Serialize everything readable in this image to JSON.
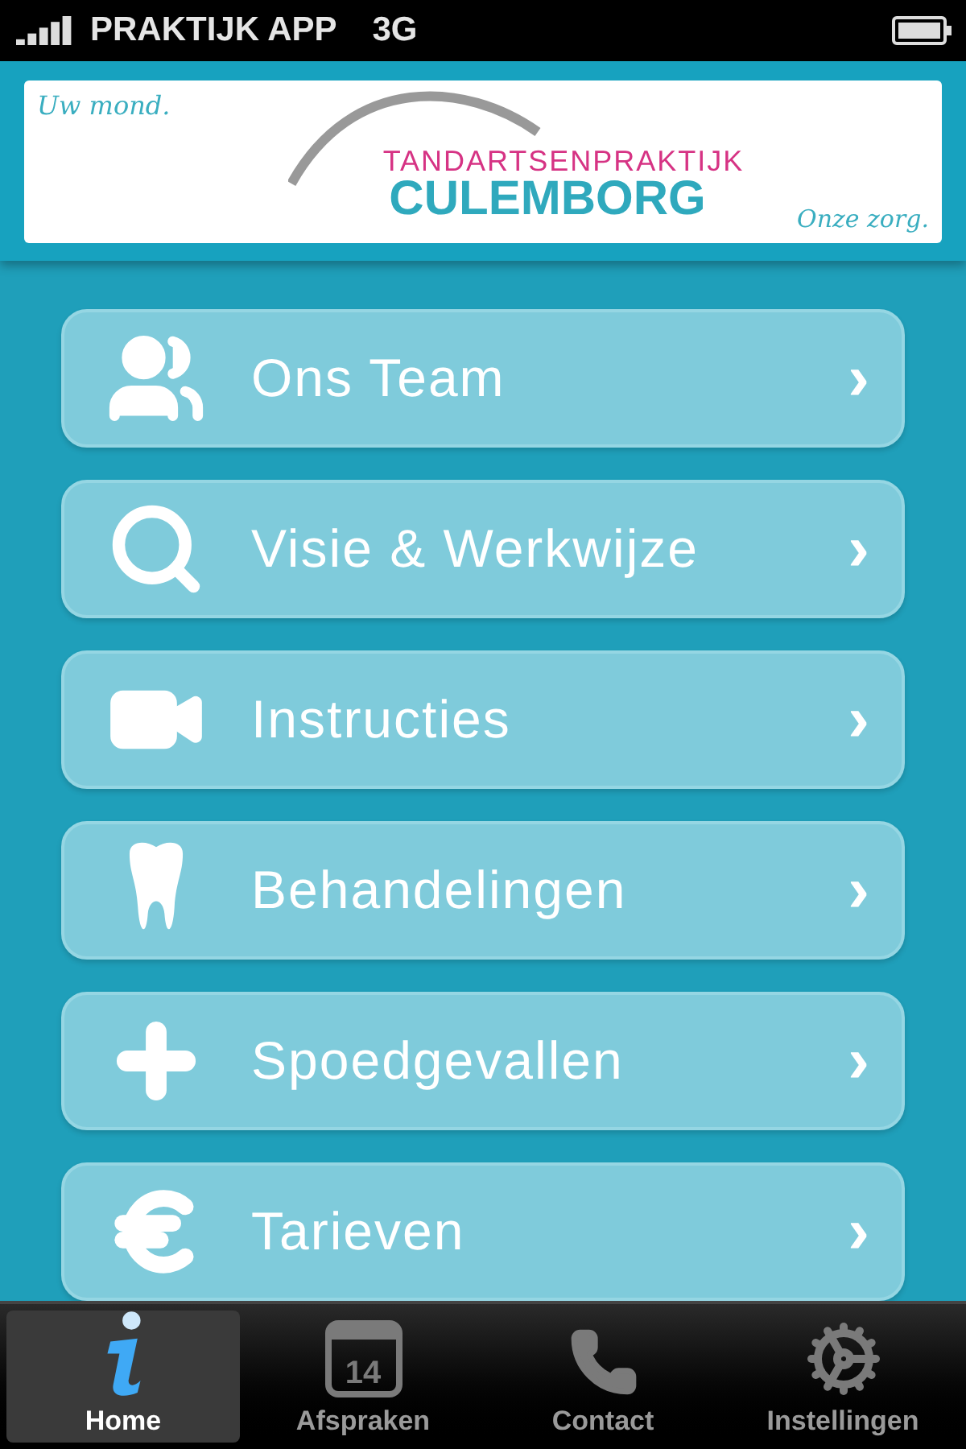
{
  "status_bar": {
    "carrier": "PRAKTIJK APP",
    "network": "3G"
  },
  "banner": {
    "slogan_left": "Uw mond.",
    "logo_top": "TANDARTSENPRAKTIJK",
    "logo_bottom": "CULEMBORG",
    "slogan_right": "Onze zorg."
  },
  "menu": [
    {
      "kind": "team",
      "label": "Ons Team",
      "chevron": "›"
    },
    {
      "kind": "search",
      "label": "Visie & Werkwijze",
      "chevron": "›"
    },
    {
      "kind": "video",
      "label": "Instructies",
      "chevron": "›"
    },
    {
      "kind": "tooth",
      "label": "Behandelingen",
      "chevron": "›"
    },
    {
      "kind": "plus",
      "label": "Spoedgevallen",
      "chevron": "›"
    },
    {
      "kind": "euro",
      "label": "Tarieven",
      "chevron": "›"
    }
  ],
  "tab_bar": [
    {
      "kind": "info",
      "label": "Home",
      "selected": true
    },
    {
      "kind": "calendar",
      "label": "Afspraken",
      "selected": false,
      "badge": "14"
    },
    {
      "kind": "phone",
      "label": "Contact",
      "selected": false
    },
    {
      "kind": "settings",
      "label": "Instellingen",
      "selected": false
    }
  ]
}
